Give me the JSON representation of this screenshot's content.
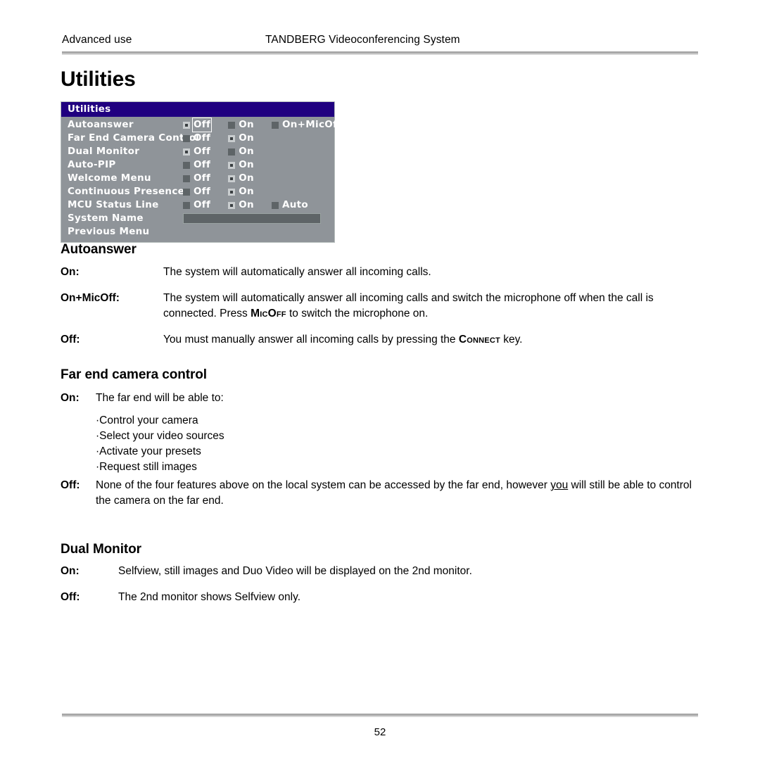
{
  "header": {
    "left": "Advanced use",
    "center": "TANDBERG Videoconferencing System"
  },
  "page_title": "Utilities",
  "osd_menu": {
    "title": "Utilities",
    "rows": [
      {
        "label": "Autoanswer",
        "options": [
          {
            "text": "Off",
            "selected": true,
            "cursor": true
          },
          {
            "text": "On",
            "selected": false,
            "cursor": false
          },
          {
            "text": "On+MicOff",
            "selected": false,
            "cursor": false
          }
        ]
      },
      {
        "label": "Far End Camera Control",
        "options": [
          {
            "text": "Off",
            "selected": false,
            "cursor": false
          },
          {
            "text": "On",
            "selected": true,
            "cursor": false
          }
        ]
      },
      {
        "label": "Dual Monitor",
        "options": [
          {
            "text": "Off",
            "selected": true,
            "cursor": false
          },
          {
            "text": "On",
            "selected": false,
            "cursor": false
          }
        ]
      },
      {
        "label": "Auto-PIP",
        "options": [
          {
            "text": "Off",
            "selected": false,
            "cursor": false
          },
          {
            "text": "On",
            "selected": true,
            "cursor": false
          }
        ]
      },
      {
        "label": "Welcome Menu",
        "options": [
          {
            "text": "Off",
            "selected": false,
            "cursor": false
          },
          {
            "text": "On",
            "selected": true,
            "cursor": false
          }
        ]
      },
      {
        "label": "Continuous Presence",
        "options": [
          {
            "text": "Off",
            "selected": false,
            "cursor": false
          },
          {
            "text": "On",
            "selected": true,
            "cursor": false
          }
        ]
      },
      {
        "label": "MCU Status Line",
        "options": [
          {
            "text": "Off",
            "selected": false,
            "cursor": false
          },
          {
            "text": "On",
            "selected": true,
            "cursor": false
          },
          {
            "text": "Auto",
            "selected": false,
            "cursor": false
          }
        ]
      }
    ],
    "system_name": {
      "label": "System Name",
      "value": "",
      "placeholder": ""
    },
    "previous_menu_label": "Previous Menu",
    "colors": {
      "titlebar": "#200080",
      "body": "#8f9499",
      "input": "#5e6467",
      "radio_unselected": "#5e6467",
      "radio_selected": "#c9cdcf"
    }
  },
  "sections": {
    "autoanswer": {
      "title": "Autoanswer",
      "rows": [
        {
          "term": "On",
          "colon": ":",
          "body": "The system will automatically answer all incoming calls."
        },
        {
          "term": "On+MicOff",
          "colon": ":",
          "body_part1": "The system will automatically answer all incoming calls and switch the microphone off when the call is connected. Press ",
          "body_smallcaps": "MicOff",
          "body_part2": " to switch the microphone on."
        },
        {
          "term": "Off",
          "colon": ":",
          "body_part1": "You must manually answer all incoming calls by pressing the ",
          "body_smallcaps": "Connect",
          "body_part2": " key."
        }
      ]
    },
    "far_end_camera_control": {
      "title": "Far end camera control",
      "on_term": "On",
      "on_colon": ":",
      "on_body": "The far end will be able to:",
      "bullets": [
        "·Control your camera",
        "·Select your video sources",
        "·Activate your presets",
        "·Request still images"
      ],
      "off_term": "Off",
      "off_colon": ":",
      "off_body_part1": "None of the four features above on the local system can be accessed by the far end, however ",
      "off_body_underlined": "you",
      "off_body_part2": " will still be able to control the camera on the far end."
    },
    "dual_monitor": {
      "title": "Dual Monitor",
      "rows": [
        {
          "term": "On",
          "colon": ":",
          "body": "Selfview, still images and Duo Video will be displayed on the 2nd monitor."
        },
        {
          "term": "Off",
          "colon": ":",
          "body": "The 2nd monitor  shows Selfview only."
        }
      ]
    }
  },
  "footer": {
    "page_number": "52"
  }
}
